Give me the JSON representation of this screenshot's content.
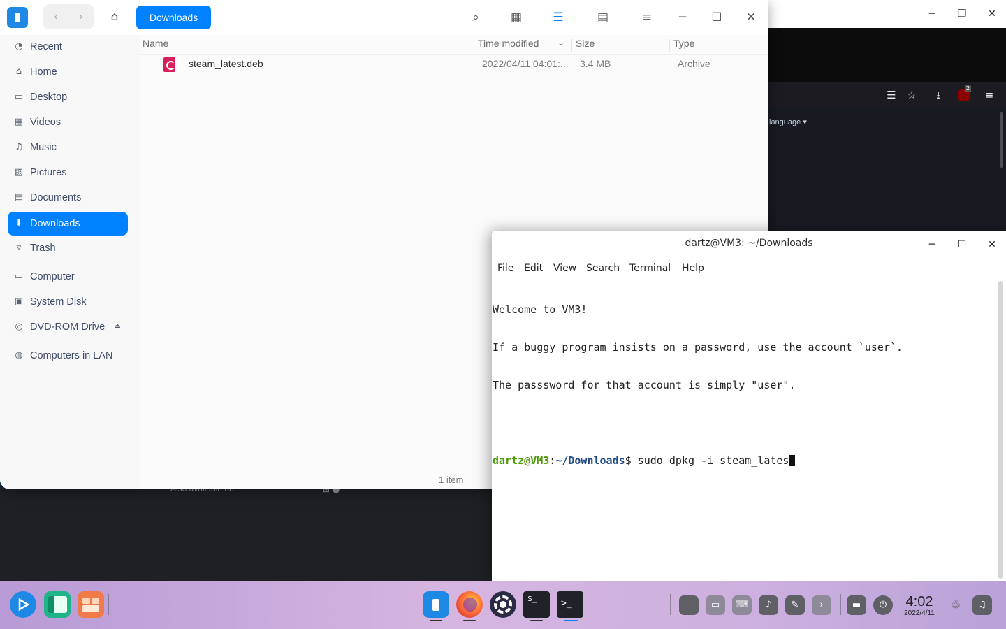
{
  "browser": {
    "window_controls": {
      "minimize": "─",
      "restore": "❐",
      "close": "✕"
    },
    "language_label": "language ▾",
    "footer_text": "Also available on:",
    "footer_os_icons": "⊞ ●",
    "toolbar": {
      "reader": "☰",
      "bookmark": "☆",
      "downloads": "⭳",
      "extension_badge": "2",
      "menu": "≡"
    }
  },
  "file_manager": {
    "breadcrumb": "Downloads",
    "nav": {
      "back": "‹",
      "forward": "›",
      "home": "⌂"
    },
    "toolbar": {
      "search": "⌕",
      "icon_view": "▦",
      "list_view": "☰",
      "details_view": "▤",
      "menu": "≡",
      "minimize": "─",
      "maximize": "☐",
      "close": "✕"
    },
    "sidebar": [
      {
        "label": "Recent",
        "icon": "◔"
      },
      {
        "label": "Home",
        "icon": "⌂"
      },
      {
        "label": "Desktop",
        "icon": "▭"
      },
      {
        "label": "Videos",
        "icon": "▦"
      },
      {
        "label": "Music",
        "icon": "♫"
      },
      {
        "label": "Pictures",
        "icon": "▨"
      },
      {
        "label": "Documents",
        "icon": "▤"
      },
      {
        "label": "Downloads",
        "icon": "⬇"
      },
      {
        "label": "Trash",
        "icon": "▿"
      },
      {
        "label": "Computer",
        "icon": "▭"
      },
      {
        "label": "System Disk",
        "icon": "▣"
      },
      {
        "label": "DVD-ROM Drive",
        "icon": "◎",
        "eject": "⏏"
      },
      {
        "label": "Computers in LAN",
        "icon": "◍"
      }
    ],
    "selected_sidebar": "Downloads",
    "columns": {
      "name": "Name",
      "time": "Time modified",
      "size": "Size",
      "type": "Type",
      "sort_icon": "⌄"
    },
    "files": [
      {
        "name": "steam_latest.deb",
        "time": "2022/04/11 04:01:...",
        "size": "3.4 MB",
        "type": "Archive"
      }
    ],
    "item_count": "1 item"
  },
  "terminal": {
    "title": "dartz@VM3: ~/Downloads",
    "controls": {
      "minimize": "─",
      "maximize": "☐",
      "close": "✕"
    },
    "menu": [
      "File",
      "Edit",
      "View",
      "Search",
      "Terminal",
      "Help"
    ],
    "output": [
      "Welcome to VM3!",
      "If a buggy program insists on a password, use the account `user`.",
      "The passsword for that account is simply \"user\"."
    ],
    "prompt_user": "dartz@VM3",
    "prompt_sep": ":",
    "prompt_path": "~/Downloads",
    "prompt_symbol": "$ ",
    "command": "sudo dpkg -i steam_lates"
  },
  "dock": {
    "clock_time": "4:02",
    "clock_date": "2022/4/11",
    "colors": {
      "launcher": "#1e88e5",
      "firefox": "#ff7139",
      "terminal": "#1f2329",
      "accent": "#0081ff"
    }
  }
}
